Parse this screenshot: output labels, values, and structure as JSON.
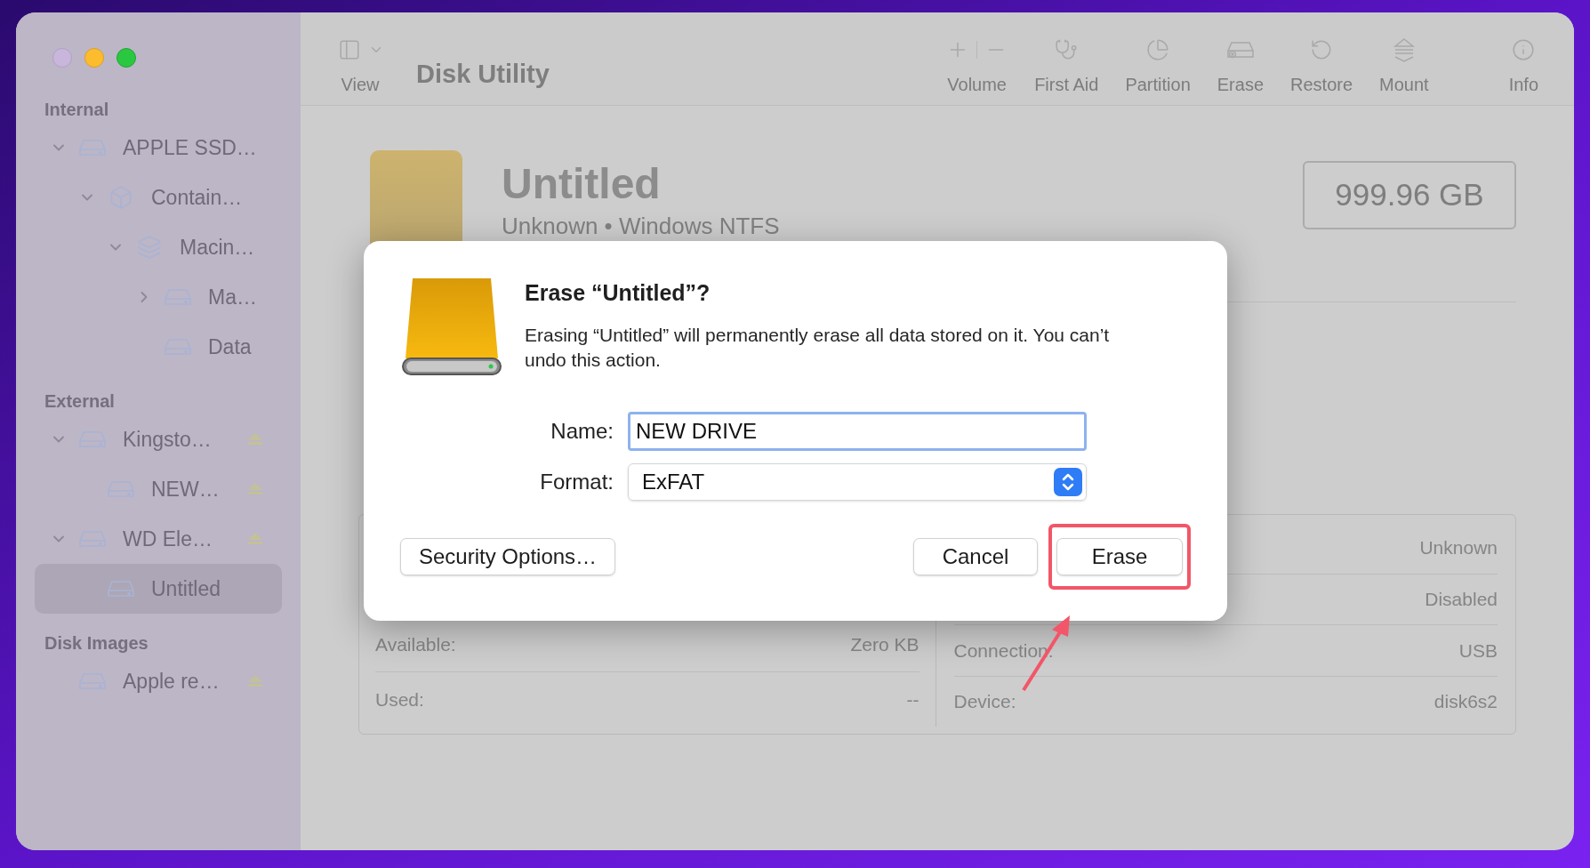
{
  "window": {
    "title": "Disk Utility"
  },
  "toolbar": {
    "view_label": "View",
    "items": [
      {
        "kind": "volume",
        "label": "Volume"
      },
      {
        "kind": "first_aid",
        "label": "First Aid"
      },
      {
        "kind": "partition",
        "label": "Partition"
      },
      {
        "kind": "erase",
        "label": "Erase"
      },
      {
        "kind": "restore",
        "label": "Restore"
      },
      {
        "kind": "mount",
        "label": "Mount"
      },
      {
        "kind": "info",
        "label": "Info"
      }
    ]
  },
  "sidebar": {
    "sections": [
      {
        "title": "Internal",
        "items": [
          {
            "kind": "drive",
            "label": "APPLE SSD…",
            "expanded": true,
            "ejectable": false,
            "selected": false,
            "children": [
              {
                "kind": "container",
                "label": "Contain…",
                "expanded": true,
                "ejectable": false,
                "selected": false,
                "children": [
                  {
                    "kind": "volume_group",
                    "label": "Macin…",
                    "expanded": true,
                    "ejectable": false,
                    "selected": false,
                    "children": [
                      {
                        "kind": "drive",
                        "label": "Ma…",
                        "expanded": false,
                        "ejectable": false,
                        "selected": false
                      },
                      {
                        "kind": "drive",
                        "label": "Data",
                        "ejectable": false,
                        "selected": false
                      }
                    ]
                  }
                ]
              }
            ]
          }
        ]
      },
      {
        "title": "External",
        "items": [
          {
            "kind": "drive",
            "label": "Kingsto…",
            "expanded": true,
            "ejectable": true,
            "selected": false,
            "children": [
              {
                "kind": "drive",
                "label": "NEW…",
                "ejectable": true,
                "selected": false
              }
            ]
          },
          {
            "kind": "drive",
            "label": "WD Ele…",
            "expanded": true,
            "ejectable": true,
            "selected": false,
            "children": [
              {
                "kind": "drive",
                "label": "Untitled",
                "ejectable": false,
                "selected": true
              }
            ]
          }
        ]
      },
      {
        "title": "Disk Images",
        "items": [
          {
            "kind": "drive",
            "label": "Apple re…",
            "ejectable": true,
            "selected": false
          }
        ]
      }
    ]
  },
  "detail": {
    "name": "Untitled",
    "subtitle": "Unknown • Windows NTFS",
    "capacity": "999.96 GB",
    "left_rows": [
      {
        "label": "Available:",
        "value": "Zero KB"
      },
      {
        "label": "Used:",
        "value": "--"
      }
    ],
    "right_rows": [
      {
        "value": "Unknown"
      },
      {
        "value": "Disabled"
      },
      {
        "label": "Connection:",
        "value": "USB"
      },
      {
        "label": "Device:",
        "value": "disk6s2"
      }
    ]
  },
  "dialog": {
    "title": "Erase “Untitled”?",
    "message": "Erasing “Untitled” will permanently erase all data stored on it. You can’t undo this action.",
    "name_label": "Name:",
    "name_value": "NEW DRIVE",
    "format_label": "Format:",
    "format_value": "ExFAT",
    "buttons": [
      {
        "kind": "secondary",
        "label": "Security Options…"
      },
      {
        "kind": "cancel",
        "label": "Cancel"
      },
      {
        "kind": "default",
        "label": "Erase",
        "highlighted": true
      }
    ]
  }
}
